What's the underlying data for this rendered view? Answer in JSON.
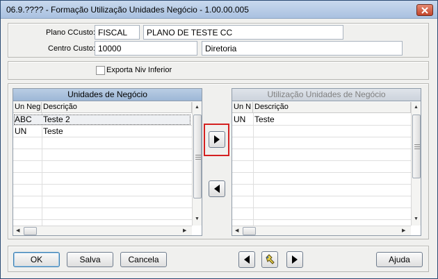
{
  "window": {
    "title": "06.9.???? - Formação Utilização Unidades Negócio - 1.00.00.005"
  },
  "header": {
    "plano_ccusto_label": "Plano CCusto:",
    "plano_ccusto_code": "FISCAL",
    "plano_ccusto_desc": "PLANO DE TESTE CC",
    "centro_custo_label": "Centro Custo:",
    "centro_custo_code": "10000",
    "centro_custo_desc": "Diretoria"
  },
  "options": {
    "exporta_label": "Exporta Niv Inferior",
    "exporta_checked": false
  },
  "left_grid": {
    "title": "Unidades de Negócio",
    "columns": [
      "Un Neg",
      "Descrição"
    ],
    "rows": [
      {
        "code": "ABC",
        "desc": "Teste 2"
      },
      {
        "code": "UN",
        "desc": "Teste"
      }
    ]
  },
  "right_grid": {
    "title": "Utilização Unidades de Negócio",
    "columns": [
      "Un N",
      "Descrição"
    ],
    "rows": [
      {
        "code": "UN",
        "desc": "Teste"
      }
    ]
  },
  "footer": {
    "ok": "OK",
    "salva": "Salva",
    "cancela": "Cancela",
    "ajuda": "Ajuda"
  },
  "colors": {
    "highlight": "#d42020",
    "grid_title_active": "#9db7d6"
  },
  "icons": {
    "move_right": "triangle-right-icon",
    "move_left": "triangle-left-icon",
    "search": "flashlight-icon"
  }
}
